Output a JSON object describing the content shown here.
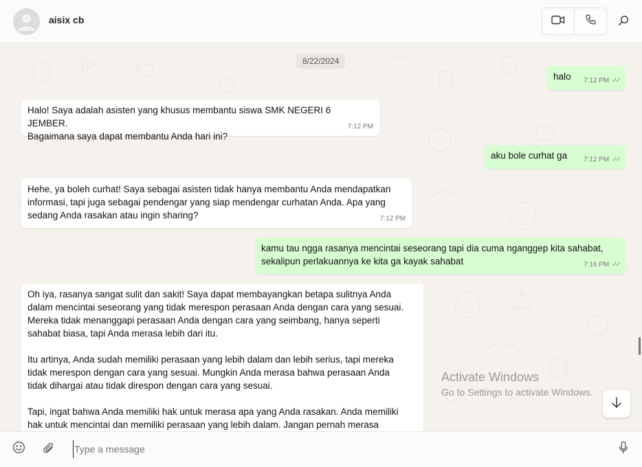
{
  "header": {
    "contact_name": "aisix cb",
    "icons": {
      "avatar": "default-avatar-icon",
      "video": "video-call-icon",
      "voice": "voice-call-icon",
      "search": "search-icon"
    }
  },
  "chat": {
    "date_label": "8/22/2024",
    "messages": [
      {
        "direction": "out",
        "text": "halo",
        "time": "7:12 PM",
        "status": "read"
      },
      {
        "direction": "in",
        "text": "Halo! Saya adalah asisten yang khusus membantu siswa SMK NEGERI 6 JEMBER.\nBagaimana saya dapat membantu Anda hari ini?",
        "time": "7:12 PM"
      },
      {
        "direction": "out",
        "text": "aku bole curhat ga",
        "time": "7:12 PM",
        "status": "read"
      },
      {
        "direction": "in",
        "text": "Hehe, ya boleh curhat! Saya sebagai asisten tidak hanya membantu Anda mendapatkan\ninformasi, tapi juga sebagai pendengar yang siap mendengar curhatan Anda. Apa yang\nsedang Anda rasakan atau ingin sharing?",
        "time": "7:12 PM"
      },
      {
        "direction": "out",
        "text": "kamu tau ngga rasanya mencintai seseorang tapi dia cuma nganggep kita sahabat,\nsekalipun perlakuannya ke kita ga kayak sahabat",
        "time": "7:16 PM",
        "status": "read"
      },
      {
        "direction": "in",
        "text": "Oh iya, rasanya sangat sulit dan sakit! Saya dapat membayangkan betapa sulitnya Anda\ndalam mencintai seseorang yang tidak merespon perasaan Anda dengan cara yang sesuai.\nMereka tidak menanggapi perasaan Anda dengan cara yang seimbang, hanya seperti\nsahabat biasa, tapi Anda merasa lebih dari itu.\n\nItu artinya, Anda sudah memiliki perasaan yang lebih dalam dan lebih serius, tapi mereka\ntidak merespon dengan cara yang sesuai. Mungkin Anda merasa bahwa perasaan Anda\ntidak dihargai atau tidak direspon dengan cara yang sesuai.\n\nTapi, ingat bahwa Anda memiliki hak untuk merasa apa yang Anda rasakan. Anda memiliki\nhak untuk mencintai dan memiliki perasaan yang lebih dalam. Jangan pernah merasa",
        "time": ""
      }
    ],
    "scroll_button_icon": "arrow-down-icon"
  },
  "watermark": {
    "line1": "Activate Windows",
    "line2": "Go to Settings to activate Windows."
  },
  "composer": {
    "placeholder": "Type a message",
    "value": "",
    "icons": {
      "emoji": "emoji-icon",
      "attach": "paperclip-icon",
      "mic": "microphone-icon"
    }
  },
  "colors": {
    "incoming_bubble": "#ffffff",
    "outgoing_bubble": "#d9fdd3",
    "chat_background": "#f5f2ee"
  }
}
